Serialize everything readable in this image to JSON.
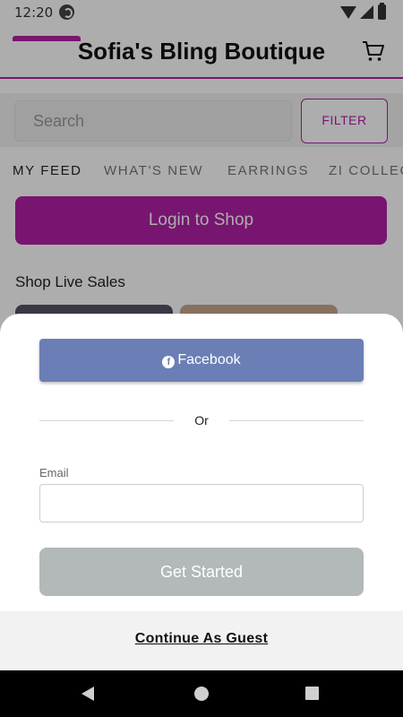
{
  "status_bar": {
    "time": "12:20"
  },
  "header": {
    "title": "Sofia's Bling Boutique",
    "cart_icon": "shopping-cart-icon"
  },
  "search": {
    "placeholder": "Search",
    "filter_label": "FILTER"
  },
  "tabs": [
    "MY FEED",
    "WHAT'S NEW",
    "EARRINGS",
    "ZI COLLEC"
  ],
  "login_shop_label": "Login to Shop",
  "live_sales_title": "Shop Live Sales",
  "sheet": {
    "facebook_label": "Facebook",
    "or_label": "Or",
    "email_label": "Email",
    "email_value": "",
    "get_started_label": "Get Started",
    "continue_guest_label": "Continue As Guest"
  },
  "colors": {
    "accent": "#b21fa6",
    "facebook": "#6b7fb6",
    "disabled_button": "#b3b8b8"
  }
}
